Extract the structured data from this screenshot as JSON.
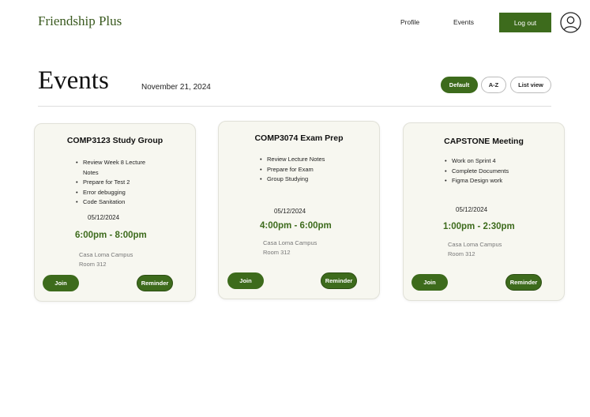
{
  "header": {
    "brand": "Friendship Plus",
    "nav": {
      "profile": "Profile",
      "events": "Events",
      "logout": "Log out"
    },
    "avatar_icon": "user-circle-icon"
  },
  "page": {
    "title": "Events",
    "date": "November 21, 2024",
    "sort_options": [
      "Default",
      "A-Z",
      "List view"
    ],
    "selected_sort": "Default"
  },
  "colors": {
    "accent": "#3d6b1c",
    "card_bg": "#f7f7f0"
  },
  "events": [
    {
      "title": "COMP3123 Study Group",
      "items": [
        "Review Week 8 Lecture",
        "Notes",
        "Prepare for Test 2",
        "Error debugging",
        "Code Sanitation"
      ],
      "date": "05/12/2024",
      "time": "6:00pm - 8:00pm",
      "location": "Casa Loma Campus",
      "room": "Room 312",
      "join_label": "Join",
      "reminder_label": "Reminder"
    },
    {
      "title": "COMP3074 Exam Prep",
      "items": [
        "Review Lecture Notes",
        "Prepare for Exam",
        "Group Studying"
      ],
      "date": "05/12/2024",
      "time": "4:00pm - 6:00pm",
      "location": "Casa Loma Campus",
      "room": "Room 312",
      "join_label": "Join",
      "reminder_label": "Reminder"
    },
    {
      "title": "CAPSTONE Meeting",
      "items": [
        "Work on Sprint 4",
        "Complete Documents",
        "Figma Design work"
      ],
      "date": "05/12/2024",
      "time": "1:00pm - 2:30pm",
      "location": "Casa Loma Campus",
      "room": "Room 312",
      "join_label": "Join",
      "reminder_label": "Reminder"
    }
  ]
}
